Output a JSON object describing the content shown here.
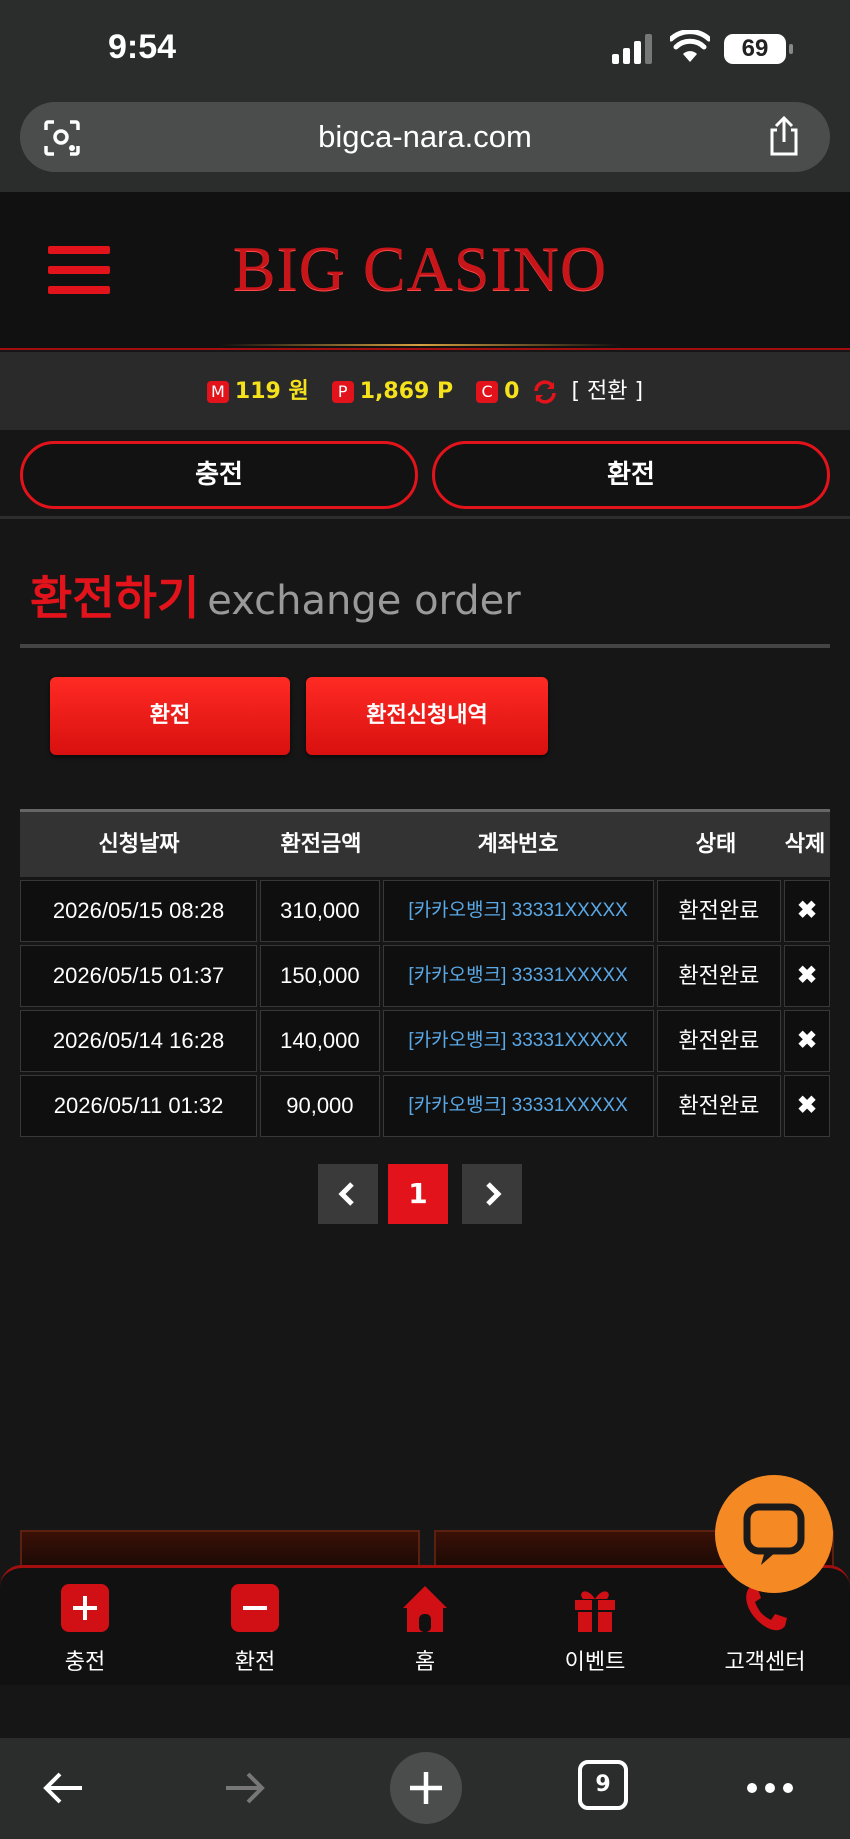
{
  "status_bar": {
    "time": "9:54",
    "battery": "69"
  },
  "browser": {
    "url": "bigca-nara.com",
    "tab_count": "9"
  },
  "header": {
    "logo": "BIG CASINO"
  },
  "balance": {
    "money_badge": "M",
    "money": "119 원",
    "point_badge": "P",
    "point": "1,869 P",
    "casino_badge": "C",
    "casino": "0",
    "switch_label": "[ 전환 ]"
  },
  "tabs": {
    "deposit": "충전",
    "withdraw": "환전"
  },
  "page_title": {
    "ko": "환전하기",
    "en": "exchange order"
  },
  "actions": {
    "exchange": "환전",
    "history": "환전신청내역"
  },
  "table": {
    "headers": [
      "신청날짜",
      "환전금액",
      "계좌번호",
      "상태",
      "삭제"
    ],
    "rows": [
      {
        "date": "2026/05/15 08:28",
        "amount": "310,000",
        "account": "[카카오뱅크] 33331XXXXX",
        "status": "환전완료",
        "delete": "✖"
      },
      {
        "date": "2026/05/15 01:37",
        "amount": "150,000",
        "account": "[카카오뱅크] 33331XXXXX",
        "status": "환전완료",
        "delete": "✖"
      },
      {
        "date": "2026/05/14 16:28",
        "amount": "140,000",
        "account": "[카카오뱅크] 33331XXXXX",
        "status": "환전완료",
        "delete": "✖"
      },
      {
        "date": "2026/05/11 01:32",
        "amount": "90,000",
        "account": "[카카오뱅크] 33331XXXXX",
        "status": "환전완료",
        "delete": "✖"
      }
    ]
  },
  "pagination": {
    "prev": "‹",
    "current": "1",
    "next": "›"
  },
  "bottom_nav": [
    {
      "label": "충전",
      "icon": "plus-icon"
    },
    {
      "label": "환전",
      "icon": "minus-icon"
    },
    {
      "label": "홈",
      "icon": "home-icon"
    },
    {
      "label": "이벤트",
      "icon": "gift-icon"
    },
    {
      "label": "고객센터",
      "icon": "phone-icon"
    }
  ],
  "colors": {
    "accent": "#e3131b",
    "gold": "#f6e21c",
    "link": "#5aa8e6",
    "chat": "#f58a25"
  }
}
